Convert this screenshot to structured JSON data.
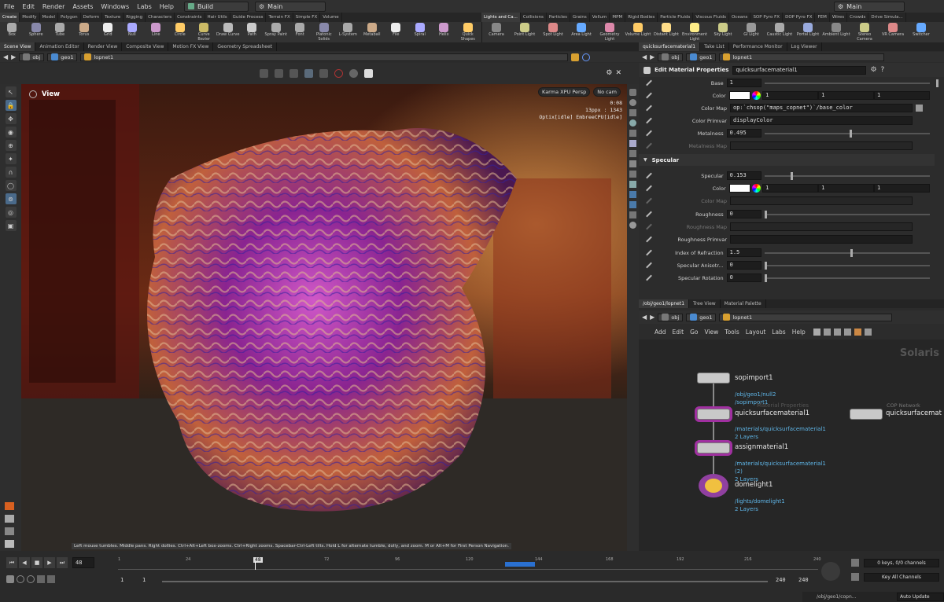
{
  "menu": {
    "items": [
      "File",
      "Edit",
      "Render",
      "Assets",
      "Windows",
      "Labs",
      "Help"
    ],
    "desktop": "Build",
    "scene": "Main",
    "right_scene": "Main"
  },
  "shelf": {
    "left_tabs": [
      "Create",
      "Modify",
      "Model",
      "Polygon",
      "Deform",
      "Texture",
      "Rigging",
      "Characters",
      "Constraints",
      "Hair Utils",
      "Guide Process",
      "Terrain FX",
      "Simple FX",
      "Volume"
    ],
    "right_tabs": [
      "Lights and Ca...",
      "Collisions",
      "Particles",
      "Grains",
      "Vellum",
      "MPM",
      "Rigid Bodies",
      "Particle Fluids",
      "Viscous Fluids",
      "Oceans",
      "SOP Pyro FX",
      "DOP Pyro FX",
      "FEM",
      "Wires",
      "Crowds",
      "Drive Simula..."
    ],
    "left_tools": [
      {
        "label": "Box",
        "icon": "box-icon"
      },
      {
        "label": "Sphere",
        "icon": "sphere-icon"
      },
      {
        "label": "Tube",
        "icon": "tube-icon"
      },
      {
        "label": "Torus",
        "icon": "torus-icon"
      },
      {
        "label": "Grid",
        "icon": "grid-icon"
      },
      {
        "label": "Null",
        "icon": "null-icon"
      },
      {
        "label": "Line",
        "icon": "line-icon"
      },
      {
        "label": "Circle",
        "icon": "circle-icon"
      },
      {
        "label": "Curve Bezier",
        "icon": "curve-bezier-icon"
      },
      {
        "label": "Draw Curve",
        "icon": "draw-curve-icon"
      },
      {
        "label": "Path",
        "icon": "path-icon"
      },
      {
        "label": "Spray Paint",
        "icon": "spray-paint-icon"
      },
      {
        "label": "Font",
        "icon": "font-icon"
      },
      {
        "label": "Platonic Solids",
        "icon": "platonic-icon"
      },
      {
        "label": "L-System",
        "icon": "lsystem-icon"
      },
      {
        "label": "Metaball",
        "icon": "metaball-icon"
      },
      {
        "label": "File",
        "icon": "file-icon"
      },
      {
        "label": "Spiral",
        "icon": "spiral-icon"
      },
      {
        "label": "Helix",
        "icon": "helix-icon"
      },
      {
        "label": "Quick Shapes",
        "icon": "quick-shapes-icon"
      }
    ],
    "right_tools": [
      {
        "label": "Camera",
        "icon": "camera-icon"
      },
      {
        "label": "Point Light",
        "icon": "point-light-icon"
      },
      {
        "label": "Spot Light",
        "icon": "spot-light-icon"
      },
      {
        "label": "Area Light",
        "icon": "area-light-icon"
      },
      {
        "label": "Geometry Light",
        "icon": "geometry-light-icon"
      },
      {
        "label": "Volume Light",
        "icon": "volume-light-icon"
      },
      {
        "label": "Distant Light",
        "icon": "distant-light-icon"
      },
      {
        "label": "Environment Light",
        "icon": "environment-light-icon"
      },
      {
        "label": "Sky Light",
        "icon": "sky-light-icon"
      },
      {
        "label": "GI Light",
        "icon": "gi-light-icon"
      },
      {
        "label": "Caustic Light",
        "icon": "caustic-light-icon"
      },
      {
        "label": "Portal Light",
        "icon": "portal-light-icon"
      },
      {
        "label": "Ambient Light",
        "icon": "ambient-light-icon"
      },
      {
        "label": "Stereo Camera",
        "icon": "stereo-camera-icon"
      },
      {
        "label": "VR Camera",
        "icon": "vr-camera-icon"
      },
      {
        "label": "Switcher",
        "icon": "switcher-icon"
      }
    ]
  },
  "left_pane": {
    "tabs": [
      "Scene View",
      "Animation Editor",
      "Render View",
      "Composite View",
      "Motion FX View",
      "Geometry Spreadsheet"
    ],
    "path": [
      "obj",
      "geo1",
      "lopnet1"
    ],
    "viewport": {
      "label": "View",
      "renderer": "Karma XPU",
      "camera_mode": "Persp",
      "camera": "No cam",
      "time": "0:08",
      "samples": "13ppx : 1343",
      "device": "Optix[idle] EmbreeCPU[idle]"
    },
    "status_hint": "Left mouse tumbles. Middle pans. Right dollies. Ctrl+Alt+Left box-zooms. Ctrl+Right zooms. Spacebar-Ctrl-Left tilts. Hold L for alternate tumble, dolly, and zoom. M or Alt+M for First Person Navigation."
  },
  "params_pane": {
    "tabs": [
      "quicksurfacematerial1",
      "Take List",
      "Performance Monitor",
      "Log Viewer"
    ],
    "path": [
      "obj",
      "geo1",
      "lopnet1"
    ],
    "header_label": "Edit Material Properties",
    "node_name": "quicksurfacematerial1",
    "params": {
      "base": {
        "label": "Base",
        "value": "1",
        "level": 1.0
      },
      "color": {
        "label": "Color",
        "r": "1",
        "g": "1",
        "b": "1"
      },
      "color_map": {
        "label": "Color Map",
        "value": "op:`chsop(\"maps_copnet\")`/base_color"
      },
      "color_primvar": {
        "label": "Color Primvar",
        "value": "displayColor"
      },
      "metalness": {
        "label": "Metalness",
        "value": "0.495",
        "level": 0.495
      },
      "metalness_map": {
        "label": "Metalness Map"
      }
    },
    "specular_section": "Specular",
    "specular": {
      "specular": {
        "label": "Specular",
        "value": "0.153",
        "level": 0.153
      },
      "color": {
        "label": "Color",
        "r": "1",
        "g": "1",
        "b": "1"
      },
      "color_map": {
        "label": "Color Map"
      },
      "roughness": {
        "label": "Roughness",
        "value": "0",
        "level": 0
      },
      "roughness_map": {
        "label": "Roughness Map"
      },
      "roughness_primvar": {
        "label": "Roughness Primvar"
      },
      "ior": {
        "label": "Index of Refraction",
        "value": "1.5",
        "level": 0.5
      },
      "anisotropy": {
        "label": "Specular Anisotr...",
        "value": "0",
        "level": 0
      },
      "rotation": {
        "label": "Specular Rotation",
        "value": "0",
        "level": 0
      }
    }
  },
  "network_pane": {
    "tabs": [
      "/obj/geo1/lopnet1",
      "Tree View",
      "Material Palette"
    ],
    "path": [
      "obj",
      "geo1",
      "lopnet1"
    ],
    "menu": [
      "Add",
      "Edit",
      "Go",
      "View",
      "Tools",
      "Layout",
      "Labs",
      "Help"
    ],
    "context_label": "Solaris",
    "nodes": [
      {
        "name": "sopimport1",
        "info": [
          "/obj/geo1/null2",
          "/sopimport1"
        ]
      },
      {
        "name": "quicksurfacematerial1",
        "info": [
          "/materials/quicksurfacematerial1",
          "2 Layers"
        ]
      },
      {
        "name": "assignmaterial1",
        "info": [
          "/materials/quicksurfacematerial1",
          "(2)",
          "2 Layers"
        ]
      },
      {
        "name": "domelight1",
        "info": [
          "/lights/domelight1",
          "2 Layers"
        ]
      }
    ],
    "ghost_label": "Material Properties",
    "cop_label": "COP Network",
    "cop_node": "quicksurfacemat"
  },
  "timeline": {
    "current_frame": "48",
    "ticks": [
      "1",
      "24",
      "48",
      "72",
      "96",
      "120",
      "144",
      "168",
      "192",
      "216",
      "240"
    ],
    "start": "1",
    "start2": "1",
    "end": "240",
    "end2": "240",
    "keys": "0 keys, 0/0 channels",
    "key_all": "Key All Channels",
    "status_path": "/obj/geo1/copn...",
    "auto_update": "Auto Update"
  }
}
